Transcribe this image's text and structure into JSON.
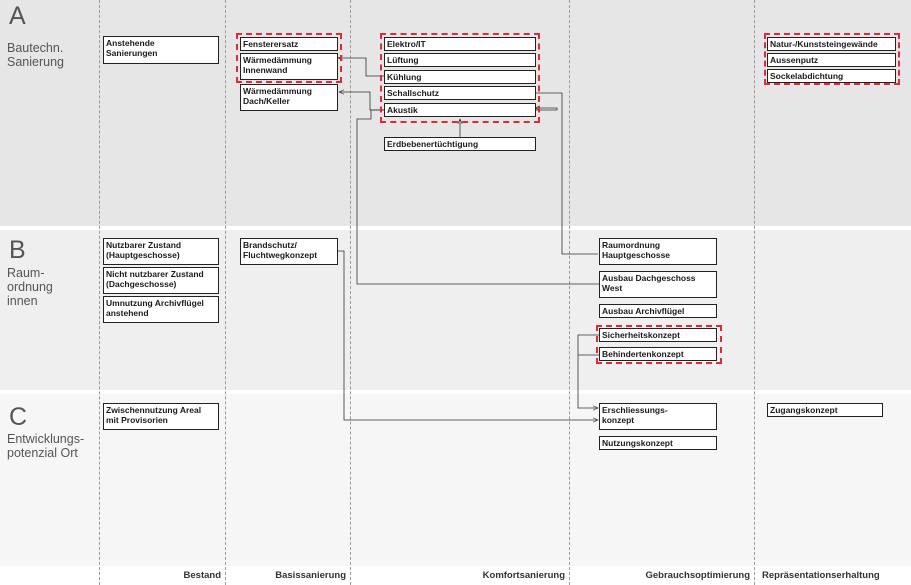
{
  "sections": {
    "a": {
      "letter": "A",
      "label_line1": "Bautechn.",
      "label_line2": "Sanierung"
    },
    "b": {
      "letter": "B",
      "label_line1": "Raum-",
      "label_line2": "ordnung",
      "label_line3": "innen"
    },
    "c": {
      "letter": "C",
      "label_line1": "Entwicklungs-",
      "label_line2": "potenzial Ort"
    }
  },
  "columns": {
    "bestand": "Bestand",
    "basis": "Basissanierung",
    "komfort": "Komfortsanierung",
    "gebrauch": "Gebrauchsoptimierung",
    "repraesentation": "Repräsentationserhaltung"
  },
  "boxes": {
    "anstehende_line1": "Anstehende",
    "anstehende_line2": "Sanierungen",
    "fensterersatz": "Fensterersatz",
    "waerme_innen_line1": "Wärmedämmung",
    "waerme_innen_line2": "Innenwand",
    "waerme_dach_line1": "Wärmedämmung",
    "waerme_dach_line2": "Dach/Keller",
    "elektro": "Elektro/IT",
    "lueftung": "Lüftung",
    "kuehlung": "Kühlung",
    "schallschutz": "Schallschutz",
    "akustik": "Akustik",
    "erdbeben": "Erdbebenertüchtigung",
    "natur": "Natur-/Kunststeingewände",
    "aussenputz": "Aussenputz",
    "sockel": "Sockelabdichtung",
    "nutzbar_line1": "Nutzbarer Zustand",
    "nutzbar_line2": "(Hauptgeschosse)",
    "nicht_nutzbar_line1": "Nicht nutzbarer Zustand",
    "nicht_nutzbar_line2": "(Dachgeschosse)",
    "umnutzung_line1": "Umnutzung Archivflügel",
    "umnutzung_line2": "anstehend",
    "brandschutz_line1": "Brandschutz/",
    "brandschutz_line2": "Fluchtwegkonzept",
    "raumordnung_line1": "Raumordnung",
    "raumordnung_line2": "Hauptgeschosse",
    "ausbau_dg_line1": "Ausbau Dachgeschoss",
    "ausbau_dg_line2": "West",
    "ausbau_archiv": "Ausbau Archivflügel",
    "sicherheit": "Sicherheitskonzept",
    "behinderten": "Behindertenkonzept",
    "zwischen_line1": "Zwischennutzung Areal",
    "zwischen_line2": "mit Provisorien",
    "erschliessung_line1": "Erschliessungs-",
    "erschliessung_line2": "konzept",
    "nutzungskonzept": "Nutzungskonzept",
    "zugang": "Zugangskonzept"
  }
}
